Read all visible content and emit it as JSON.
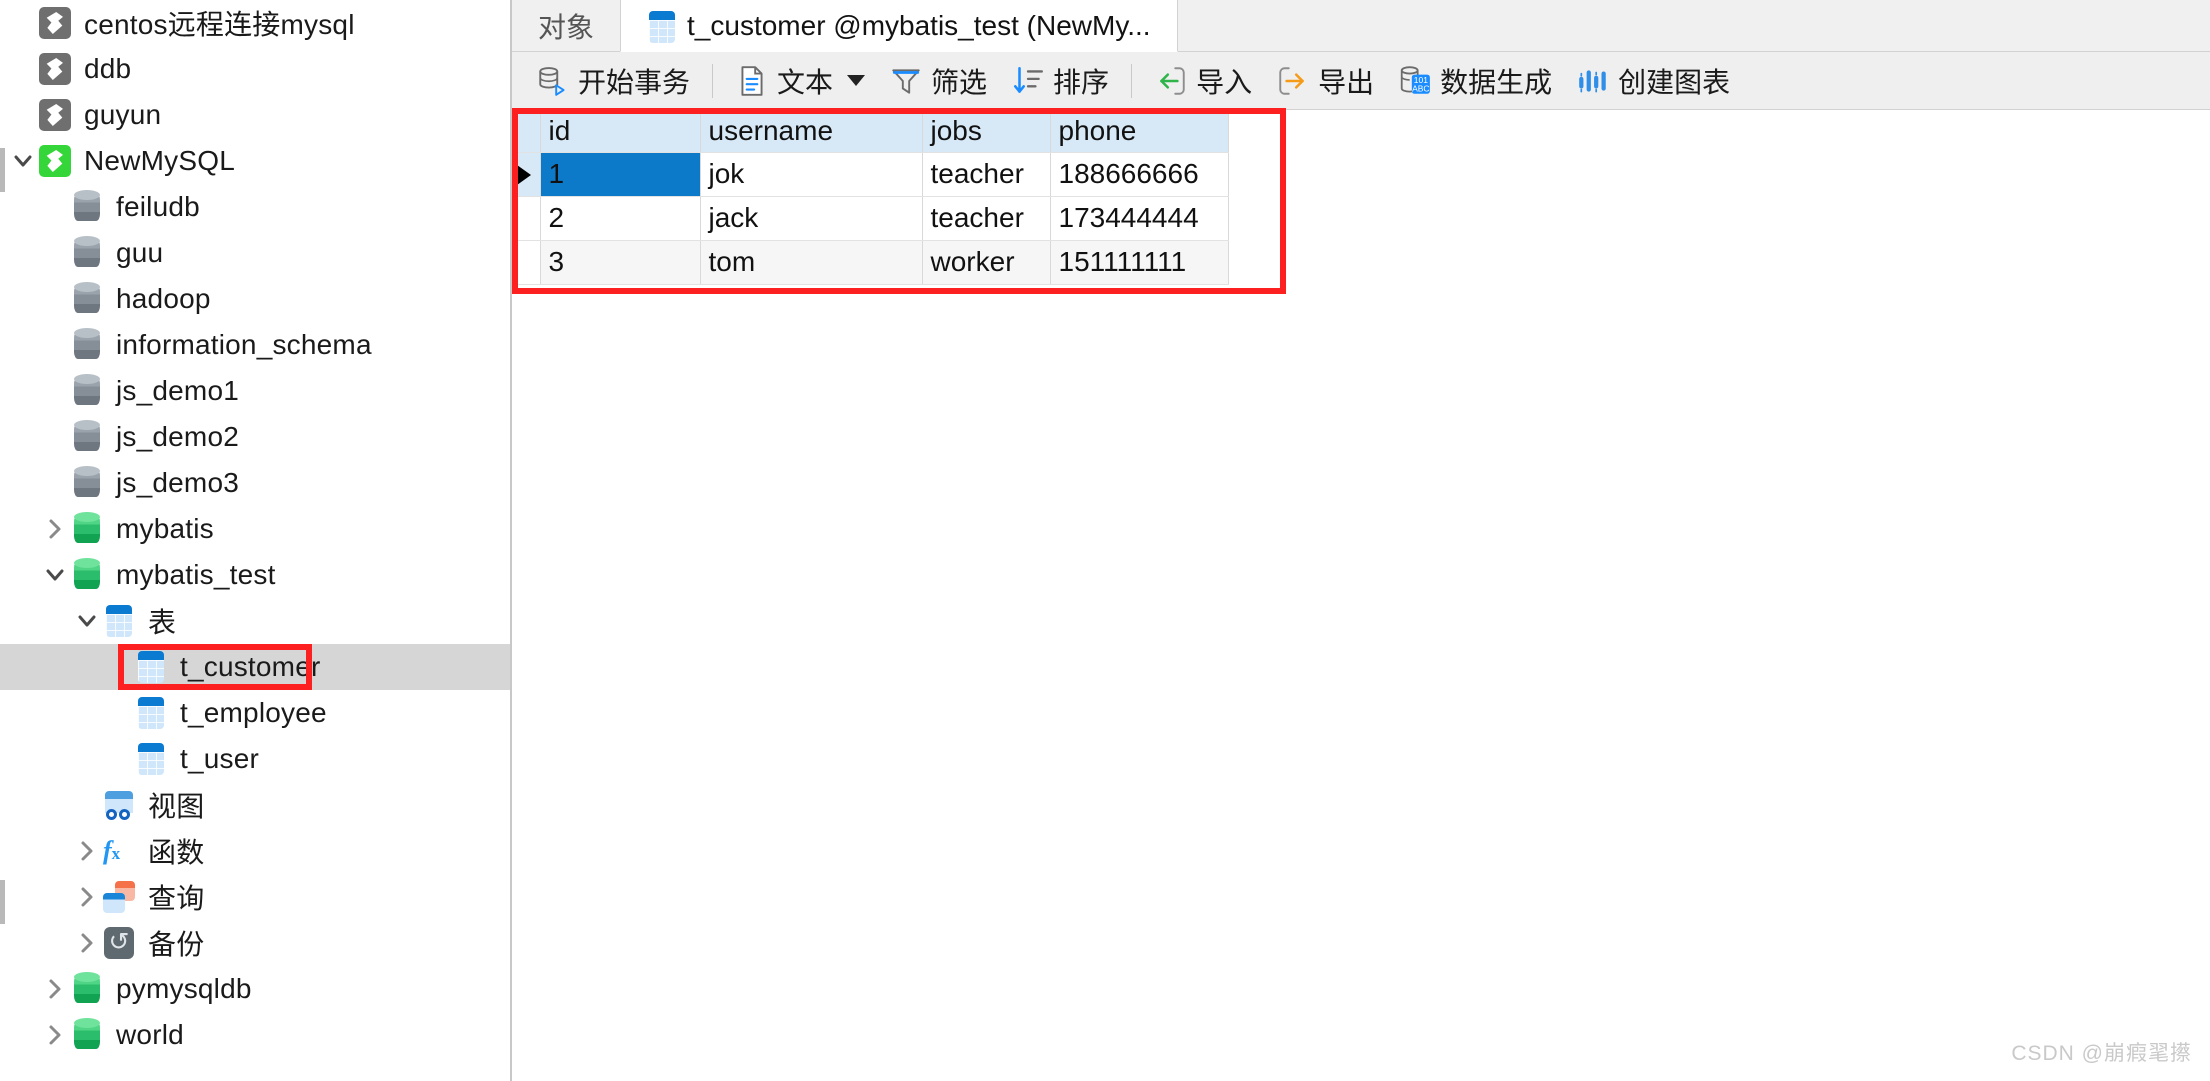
{
  "sidebar": {
    "items": [
      {
        "label": "centos远程连接mysql",
        "icon": "connection-icon",
        "indent": 0,
        "twisty": "",
        "state": "inactive"
      },
      {
        "label": "ddb",
        "icon": "connection-icon",
        "indent": 0,
        "twisty": "",
        "state": "inactive"
      },
      {
        "label": "guyun",
        "icon": "connection-icon",
        "indent": 0,
        "twisty": "",
        "state": "inactive"
      },
      {
        "label": "NewMySQL",
        "icon": "connection-icon",
        "indent": 0,
        "twisty": "expanded",
        "state": "active"
      },
      {
        "label": "feiludb",
        "icon": "database-icon",
        "indent": 1,
        "twisty": "",
        "state": "inactive"
      },
      {
        "label": "guu",
        "icon": "database-icon",
        "indent": 1,
        "twisty": "",
        "state": "inactive"
      },
      {
        "label": "hadoop",
        "icon": "database-icon",
        "indent": 1,
        "twisty": "",
        "state": "inactive"
      },
      {
        "label": "information_schema",
        "icon": "database-icon",
        "indent": 1,
        "twisty": "",
        "state": "inactive"
      },
      {
        "label": "js_demo1",
        "icon": "database-icon",
        "indent": 1,
        "twisty": "",
        "state": "inactive"
      },
      {
        "label": "js_demo2",
        "icon": "database-icon",
        "indent": 1,
        "twisty": "",
        "state": "inactive"
      },
      {
        "label": "js_demo3",
        "icon": "database-icon",
        "indent": 1,
        "twisty": "",
        "state": "inactive"
      },
      {
        "label": "mybatis",
        "icon": "database-icon",
        "indent": 1,
        "twisty": "collapsed",
        "state": "active"
      },
      {
        "label": "mybatis_test",
        "icon": "database-icon",
        "indent": 1,
        "twisty": "expanded",
        "state": "active"
      },
      {
        "label": "表",
        "icon": "table-folder-icon",
        "indent": 2,
        "twisty": "expanded",
        "state": "active"
      },
      {
        "label": "t_customer",
        "icon": "table-icon",
        "indent": 3,
        "twisty": "",
        "state": "selected"
      },
      {
        "label": "t_employee",
        "icon": "table-icon",
        "indent": 3,
        "twisty": "",
        "state": "inactive"
      },
      {
        "label": "t_user",
        "icon": "table-icon",
        "indent": 3,
        "twisty": "",
        "state": "inactive"
      },
      {
        "label": "视图",
        "icon": "view-icon",
        "indent": 2,
        "twisty": "",
        "state": "inactive"
      },
      {
        "label": "函数",
        "icon": "function-icon",
        "indent": 2,
        "twisty": "collapsed",
        "state": "inactive"
      },
      {
        "label": "查询",
        "icon": "query-icon",
        "indent": 2,
        "twisty": "collapsed",
        "state": "inactive"
      },
      {
        "label": "备份",
        "icon": "backup-icon",
        "indent": 2,
        "twisty": "collapsed",
        "state": "inactive"
      },
      {
        "label": "pymysqldb",
        "icon": "database-icon",
        "indent": 1,
        "twisty": "collapsed",
        "state": "active"
      },
      {
        "label": "world",
        "icon": "database-icon",
        "indent": 1,
        "twisty": "collapsed",
        "state": "active"
      }
    ]
  },
  "tabs": [
    {
      "label": "对象",
      "active": false,
      "icon": ""
    },
    {
      "label": "t_customer @mybatis_test (NewMy...",
      "active": true,
      "icon": "table-icon"
    }
  ],
  "toolbar": {
    "groups": [
      [
        {
          "label": "开始事务",
          "icon": "begin-transaction-icon",
          "caret": false
        }
      ],
      [
        {
          "label": "文本",
          "icon": "text-document-icon",
          "caret": true
        },
        {
          "label": "筛选",
          "icon": "filter-funnel-icon",
          "caret": false
        },
        {
          "label": "排序",
          "icon": "sort-icon",
          "caret": false
        }
      ],
      [
        {
          "label": "导入",
          "icon": "import-icon",
          "caret": false
        },
        {
          "label": "导出",
          "icon": "export-icon",
          "caret": false
        },
        {
          "label": "数据生成",
          "icon": "data-generation-icon",
          "caret": false
        },
        {
          "label": "创建图表",
          "icon": "create-chart-icon",
          "caret": false
        }
      ]
    ]
  },
  "grid": {
    "columns": [
      "id",
      "username",
      "jobs",
      "phone"
    ],
    "rows": [
      {
        "id": "1",
        "username": "jok",
        "jobs": "teacher",
        "phone": "188666666"
      },
      {
        "id": "2",
        "username": "jack",
        "jobs": "teacher",
        "phone": "173444444"
      },
      {
        "id": "3",
        "username": "tom",
        "jobs": "worker",
        "phone": "151111111"
      }
    ],
    "selected_row": 0,
    "selected_column": "id"
  },
  "annotations": {
    "accent_color": "#fc2020",
    "selection_color": "#0d7ac9",
    "header_color": "#d7e8f7"
  },
  "watermark": "CSDN @崩瘕毣攃"
}
